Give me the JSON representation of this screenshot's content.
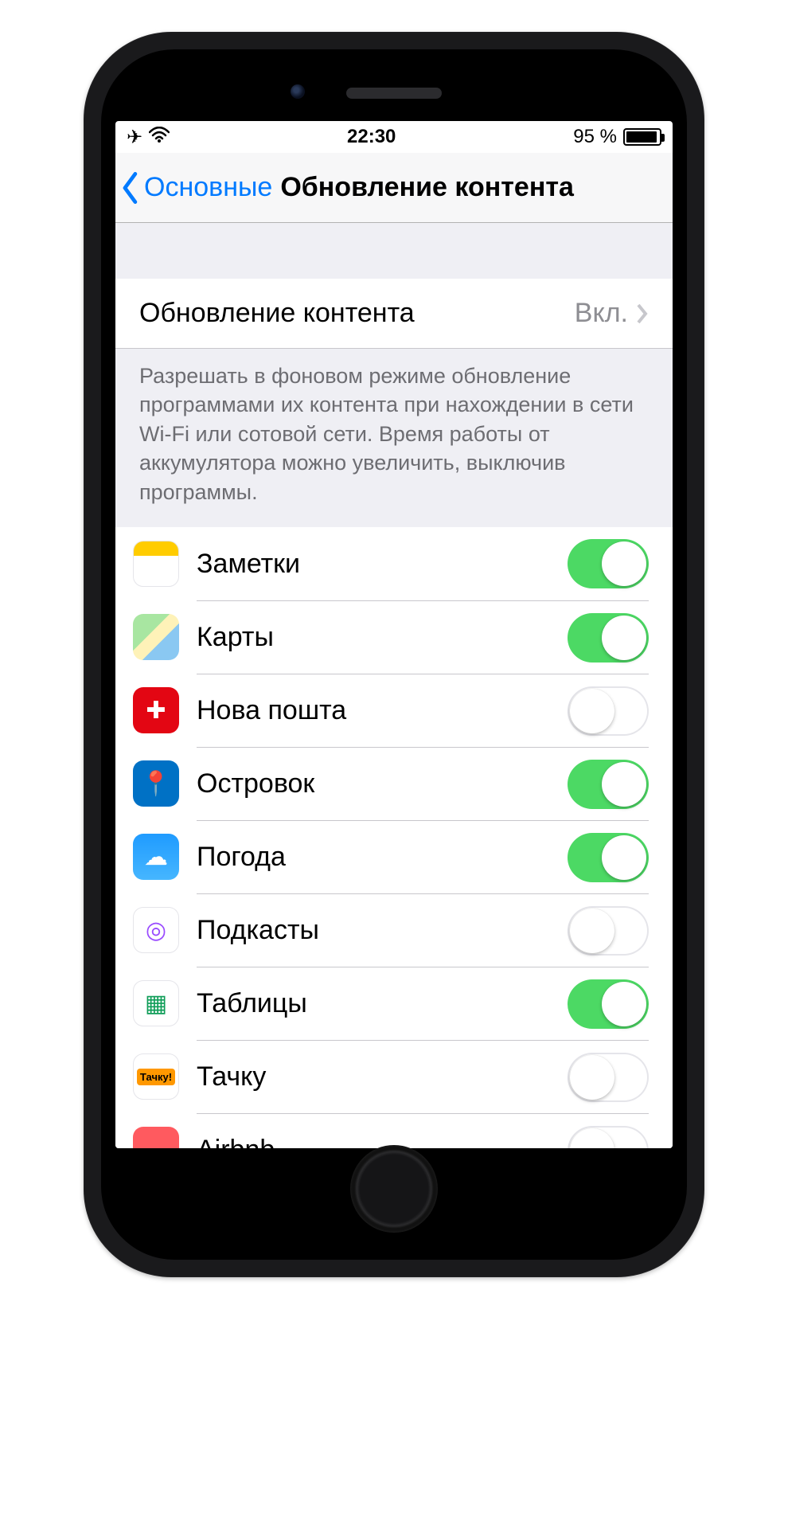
{
  "status": {
    "time": "22:30",
    "battery_pct": "95 %",
    "battery_fill_pct": 95
  },
  "nav": {
    "back_label": "Основные",
    "title": "Обновление контента"
  },
  "master": {
    "label": "Обновление контента",
    "value": "Вкл."
  },
  "footer": "Разрешать в фоновом режиме обновление программами их контента при нахождении в сети Wi-Fi или сотовой сети. Время работы от аккумулятора можно увеличить, выключив программы.",
  "apps": [
    {
      "name": "Заметки",
      "icon": "notes",
      "enabled": true
    },
    {
      "name": "Карты",
      "icon": "maps",
      "enabled": true
    },
    {
      "name": "Нова пошта",
      "icon": "nova",
      "enabled": false
    },
    {
      "name": "Островок",
      "icon": "ostrovok",
      "enabled": true
    },
    {
      "name": "Погода",
      "icon": "weather",
      "enabled": true
    },
    {
      "name": "Подкасты",
      "icon": "podcasts",
      "enabled": false
    },
    {
      "name": "Таблицы",
      "icon": "sheets",
      "enabled": true
    },
    {
      "name": "Тачку",
      "icon": "tachku",
      "enabled": false
    },
    {
      "name": "Airbnb",
      "icon": "airbnb",
      "enabled": false
    }
  ],
  "icon_glyphs": {
    "notes": "",
    "maps": "",
    "nova": "✚",
    "ostrovok": "📍",
    "weather": "☁",
    "podcasts": "◎",
    "sheets": "▦",
    "tachku": "Тачку!",
    "airbnb": "◡"
  }
}
